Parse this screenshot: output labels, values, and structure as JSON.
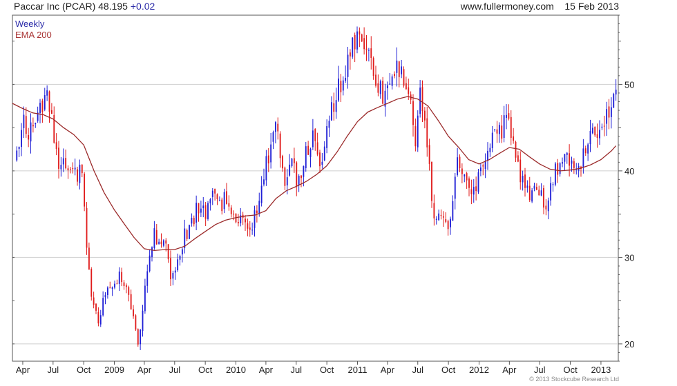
{
  "header": {
    "name": "Paccar Inc (PCAR)",
    "last": "48.195",
    "change": "+0.02",
    "site": "www.fullermoney.com",
    "date": "15 Feb 2013"
  },
  "copyright": "© 2013 Stockcube Research Ltd",
  "colors": {
    "up": "#1f1fd6",
    "down": "#e01b1b",
    "ema": "#9b2a2a",
    "grid": "#cfcfcf",
    "frame": "#555555"
  },
  "chart_data": {
    "type": "candlestick",
    "legend": [
      "Weekly",
      "EMA 200"
    ],
    "legend_position": "top-left",
    "y_axis_side": "right",
    "grid": true,
    "ylim": [
      18,
      58
    ],
    "y_ticks": [
      20,
      30,
      40,
      50
    ],
    "x_range": [
      "2008-03-01",
      "2013-02-22"
    ],
    "x_ticks": [
      {
        "label": "Apr",
        "date": "2008-04-01"
      },
      {
        "label": "Jul",
        "date": "2008-07-01"
      },
      {
        "label": "Oct",
        "date": "2008-10-01"
      },
      {
        "label": "2009",
        "date": "2009-01-01"
      },
      {
        "label": "Apr",
        "date": "2009-04-01"
      },
      {
        "label": "Jul",
        "date": "2009-07-01"
      },
      {
        "label": "Oct",
        "date": "2009-10-01"
      },
      {
        "label": "2010",
        "date": "2010-01-01"
      },
      {
        "label": "Apr",
        "date": "2010-04-01"
      },
      {
        "label": "Jul",
        "date": "2010-07-01"
      },
      {
        "label": "Oct",
        "date": "2010-10-01"
      },
      {
        "label": "2011",
        "date": "2011-01-01"
      },
      {
        "label": "Apr",
        "date": "2011-04-01"
      },
      {
        "label": "Jul",
        "date": "2011-07-01"
      },
      {
        "label": "Oct",
        "date": "2011-10-01"
      },
      {
        "label": "2012",
        "date": "2012-01-01"
      },
      {
        "label": "Apr",
        "date": "2012-04-01"
      },
      {
        "label": "Jul",
        "date": "2012-07-01"
      },
      {
        "label": "Oct",
        "date": "2012-10-01"
      },
      {
        "label": "2013",
        "date": "2013-01-01"
      }
    ],
    "price_path": [
      [
        "2008-03-07",
        41.5
      ],
      [
        "2008-04-04",
        45.5
      ],
      [
        "2008-05-02",
        44.0
      ],
      [
        "2008-05-30",
        47.5
      ],
      [
        "2008-06-13",
        50.5
      ],
      [
        "2008-06-27",
        45.5
      ],
      [
        "2008-07-18",
        40.0
      ],
      [
        "2008-08-15",
        41.0
      ],
      [
        "2008-09-05",
        39.5
      ],
      [
        "2008-09-26",
        40.5
      ],
      [
        "2008-10-10",
        31.0
      ],
      [
        "2008-10-24",
        25.5
      ],
      [
        "2008-11-14",
        23.0
      ],
      [
        "2008-12-05",
        25.5
      ],
      [
        "2008-12-26",
        27.0
      ],
      [
        "2009-01-16",
        28.0
      ],
      [
        "2009-02-06",
        26.0
      ],
      [
        "2009-02-27",
        23.5
      ],
      [
        "2009-03-13",
        20.5
      ],
      [
        "2009-03-27",
        24.0
      ],
      [
        "2009-04-10",
        29.0
      ],
      [
        "2009-05-01",
        33.0
      ],
      [
        "2009-05-22",
        31.0
      ],
      [
        "2009-06-05",
        32.5
      ],
      [
        "2009-06-19",
        28.0
      ],
      [
        "2009-07-10",
        29.0
      ],
      [
        "2009-07-31",
        32.5
      ],
      [
        "2009-08-21",
        34.0
      ],
      [
        "2009-09-11",
        36.0
      ],
      [
        "2009-10-02",
        35.0
      ],
      [
        "2009-10-23",
        37.5
      ],
      [
        "2009-11-13",
        36.0
      ],
      [
        "2009-12-04",
        37.0
      ],
      [
        "2009-12-25",
        35.0
      ],
      [
        "2010-01-22",
        34.5
      ],
      [
        "2010-02-12",
        33.0
      ],
      [
        "2010-03-05",
        35.5
      ],
      [
        "2010-03-26",
        40.0
      ],
      [
        "2010-04-16",
        43.0
      ],
      [
        "2010-04-30",
        45.5
      ],
      [
        "2010-05-14",
        41.5
      ],
      [
        "2010-05-28",
        38.5
      ],
      [
        "2010-06-18",
        40.5
      ],
      [
        "2010-07-09",
        38.5
      ],
      [
        "2010-07-30",
        42.0
      ],
      [
        "2010-08-20",
        43.5
      ],
      [
        "2010-09-10",
        41.0
      ],
      [
        "2010-10-01",
        44.5
      ],
      [
        "2010-10-22",
        48.0
      ],
      [
        "2010-11-12",
        50.5
      ],
      [
        "2010-12-03",
        53.0
      ],
      [
        "2010-12-24",
        55.0
      ],
      [
        "2011-01-14",
        56.0
      ],
      [
        "2011-02-04",
        53.5
      ],
      [
        "2011-02-25",
        50.5
      ],
      [
        "2011-03-18",
        48.5
      ],
      [
        "2011-04-08",
        51.0
      ],
      [
        "2011-04-29",
        52.5
      ],
      [
        "2011-05-20",
        50.0
      ],
      [
        "2011-06-10",
        47.0
      ],
      [
        "2011-06-24",
        44.0
      ],
      [
        "2011-07-08",
        50.0
      ],
      [
        "2011-07-22",
        46.0
      ],
      [
        "2011-08-05",
        40.0
      ],
      [
        "2011-08-19",
        35.0
      ],
      [
        "2011-09-09",
        34.5
      ],
      [
        "2011-09-30",
        33.0
      ],
      [
        "2011-10-14",
        36.5
      ],
      [
        "2011-10-28",
        42.0
      ],
      [
        "2011-11-18",
        38.5
      ],
      [
        "2011-12-09",
        37.5
      ],
      [
        "2012-01-06",
        40.0
      ],
      [
        "2012-01-27",
        42.5
      ],
      [
        "2012-02-17",
        45.5
      ],
      [
        "2012-03-09",
        44.5
      ],
      [
        "2012-03-23",
        46.5
      ],
      [
        "2012-04-06",
        45.0
      ],
      [
        "2012-04-20",
        41.0
      ],
      [
        "2012-05-11",
        39.0
      ],
      [
        "2012-06-01",
        36.5
      ],
      [
        "2012-06-22",
        38.0
      ],
      [
        "2012-07-13",
        36.5
      ],
      [
        "2012-07-27",
        36.0
      ],
      [
        "2012-08-10",
        39.5
      ],
      [
        "2012-08-31",
        40.5
      ],
      [
        "2012-09-21",
        41.5
      ],
      [
        "2012-10-12",
        40.0
      ],
      [
        "2012-10-26",
        39.5
      ],
      [
        "2012-11-16",
        42.5
      ],
      [
        "2012-12-07",
        44.0
      ],
      [
        "2012-12-28",
        44.5
      ],
      [
        "2013-01-18",
        46.0
      ],
      [
        "2013-02-01",
        47.5
      ],
      [
        "2013-02-15",
        48.195
      ]
    ],
    "ema_200": [
      [
        "2008-03-01",
        47.8
      ],
      [
        "2008-04-01",
        47.2
      ],
      [
        "2008-05-01",
        46.7
      ],
      [
        "2008-06-01",
        46.5
      ],
      [
        "2008-07-01",
        46.0
      ],
      [
        "2008-08-01",
        45.0
      ],
      [
        "2008-09-01",
        44.2
      ],
      [
        "2008-10-01",
        43.0
      ],
      [
        "2008-11-01",
        40.0
      ],
      [
        "2008-12-01",
        37.5
      ],
      [
        "2009-01-01",
        35.5
      ],
      [
        "2009-02-01",
        33.8
      ],
      [
        "2009-03-01",
        32.3
      ],
      [
        "2009-04-01",
        31.0
      ],
      [
        "2009-05-01",
        30.8
      ],
      [
        "2009-06-01",
        30.9
      ],
      [
        "2009-07-01",
        30.9
      ],
      [
        "2009-08-01",
        31.3
      ],
      [
        "2009-09-01",
        32.2
      ],
      [
        "2009-10-01",
        33.0
      ],
      [
        "2009-11-01",
        33.8
      ],
      [
        "2009-12-01",
        34.3
      ],
      [
        "2010-01-01",
        34.6
      ],
      [
        "2010-02-01",
        34.8
      ],
      [
        "2010-03-01",
        34.9
      ],
      [
        "2010-04-01",
        35.4
      ],
      [
        "2010-05-01",
        36.8
      ],
      [
        "2010-06-01",
        37.7
      ],
      [
        "2010-07-01",
        38.2
      ],
      [
        "2010-08-01",
        38.8
      ],
      [
        "2010-09-01",
        39.6
      ],
      [
        "2010-10-01",
        40.6
      ],
      [
        "2010-11-01",
        42.2
      ],
      [
        "2010-12-01",
        44.0
      ],
      [
        "2011-01-01",
        45.7
      ],
      [
        "2011-02-01",
        46.8
      ],
      [
        "2011-03-01",
        47.3
      ],
      [
        "2011-04-01",
        47.8
      ],
      [
        "2011-05-01",
        48.3
      ],
      [
        "2011-06-01",
        48.6
      ],
      [
        "2011-07-01",
        48.3
      ],
      [
        "2011-08-01",
        47.5
      ],
      [
        "2011-09-01",
        45.8
      ],
      [
        "2011-10-01",
        44.0
      ],
      [
        "2011-11-01",
        42.7
      ],
      [
        "2011-12-01",
        41.3
      ],
      [
        "2012-01-01",
        40.8
      ],
      [
        "2012-02-01",
        41.3
      ],
      [
        "2012-03-01",
        42.0
      ],
      [
        "2012-04-01",
        42.7
      ],
      [
        "2012-05-01",
        42.5
      ],
      [
        "2012-06-01",
        41.6
      ],
      [
        "2012-07-01",
        40.8
      ],
      [
        "2012-08-01",
        40.2
      ],
      [
        "2012-09-01",
        40.0
      ],
      [
        "2012-10-01",
        40.1
      ],
      [
        "2012-11-01",
        40.3
      ],
      [
        "2012-12-01",
        40.7
      ],
      [
        "2013-01-01",
        41.3
      ],
      [
        "2013-02-01",
        42.3
      ],
      [
        "2013-02-15",
        42.9
      ]
    ]
  }
}
